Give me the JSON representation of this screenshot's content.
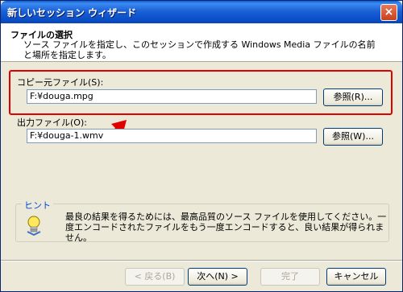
{
  "window": {
    "title": "新しいセッション ウィザード",
    "close_label": "×"
  },
  "header": {
    "title": "ファイルの選択",
    "description": "ソース ファイルを指定し、このセッションで作成する Windows Media ファイルの名前と場所を指定します。"
  },
  "source": {
    "label": "コピー元ファイル(S):",
    "value": "F:¥douga.mpg",
    "browse_label": "参照(R)..."
  },
  "output": {
    "label": "出力ファイル(O):",
    "value": "F:¥douga-1.wmv",
    "browse_label": "参照(W)..."
  },
  "hint": {
    "label": "ヒント",
    "text": "最良の結果を得るためには、最高品質のソース ファイルを使用してください。一度エンコードされたファイルをもう一度エンコードすると、良い結果が得られません。"
  },
  "buttons": {
    "back": "< 戻る(B)",
    "next": "次へ(N) >",
    "finish": "完了",
    "cancel": "キャンセル"
  },
  "colors": {
    "highlight": "#e00000",
    "titlebar": "#0b4fc9"
  }
}
